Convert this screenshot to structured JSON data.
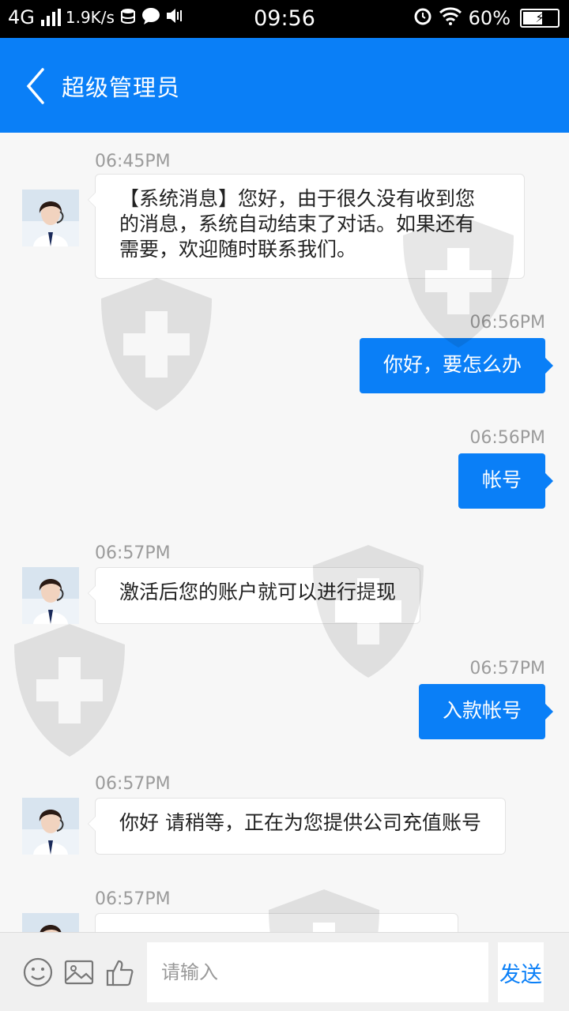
{
  "status_bar": {
    "network": "4G",
    "speed": "1.9K/s",
    "time": "09:56",
    "battery": "60%",
    "battery_level": 0.6,
    "icons": [
      "signal-icon",
      "data-icon",
      "chat-icon",
      "mute-icon",
      "alarm-icon",
      "wifi-icon",
      "battery-icon"
    ]
  },
  "header": {
    "title": "超级管理员",
    "back_icon": "chevron-left-icon"
  },
  "messages": [
    {
      "side": "left",
      "time": "06:45PM",
      "lines": [
        "【系统消息】您好，由于很久没有收到您",
        "的消息，系统自动结束了对话。如果还有",
        "需要，欢迎随时联系我们。"
      ]
    },
    {
      "side": "right",
      "time": "06:56PM",
      "text": "你好，要怎么办"
    },
    {
      "side": "right",
      "time": "06:56PM",
      "text": "帐号"
    },
    {
      "side": "left",
      "time": "06:57PM",
      "text": "激活后您的账户就可以进行提现"
    },
    {
      "side": "right",
      "time": "06:57PM",
      "text": "入款帐号"
    },
    {
      "side": "left",
      "time": "06:57PM",
      "text": "你好 请稍等，正在为您提供公司充值账号"
    },
    {
      "side": "left",
      "time": "06:57PM",
      "text": ""
    }
  ],
  "input_bar": {
    "placeholder": "请输入",
    "send_label": "发送",
    "icons": [
      "emoji-icon",
      "image-icon",
      "thumbs-up-icon"
    ]
  },
  "colors": {
    "accent": "#0a7ff7",
    "background": "#f7f7f7",
    "time_text": "#9b9b9b"
  }
}
